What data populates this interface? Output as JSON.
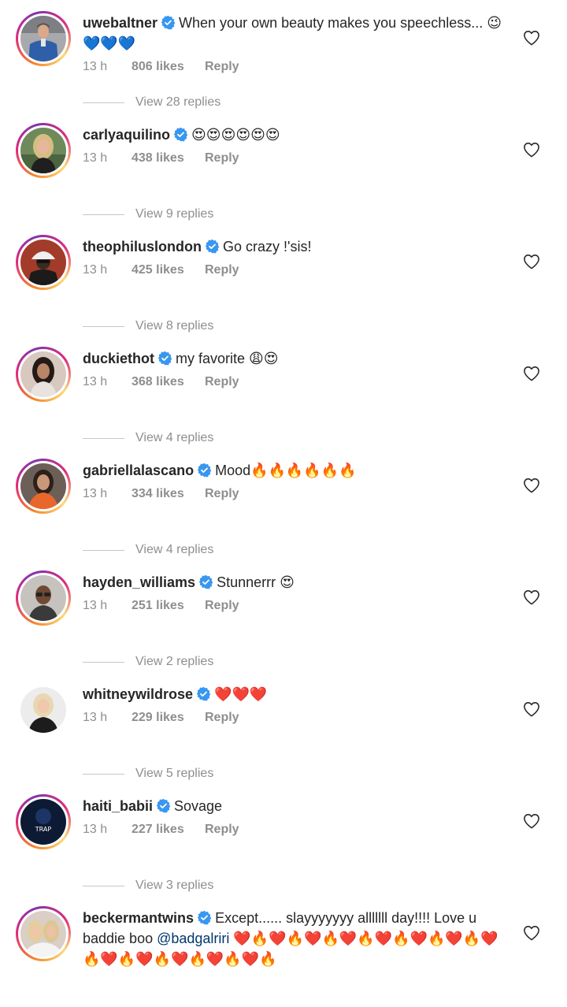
{
  "comments": [
    {
      "username": "uwebaltner",
      "text": "When your own beauty makes you speechless... 😉💙💙💙",
      "time": "13 h",
      "likes": "806 likes",
      "reply": "Reply",
      "view_replies": "View 28 replies",
      "has_story": true
    },
    {
      "username": "carlyaquilino",
      "text": "😍😍😍😍😍😍",
      "time": "13 h",
      "likes": "438 likes",
      "reply": "Reply",
      "view_replies": "View 9 replies",
      "has_story": true
    },
    {
      "username": "theophiluslondon",
      "text": "Go crazy !'sis!",
      "time": "13 h",
      "likes": "425 likes",
      "reply": "Reply",
      "view_replies": "View 8 replies",
      "has_story": true
    },
    {
      "username": "duckiethot",
      "text": "my favorite 😩😍",
      "time": "13 h",
      "likes": "368 likes",
      "reply": "Reply",
      "view_replies": "View 4 replies",
      "has_story": true
    },
    {
      "username": "gabriellalascano",
      "text": "Mood🔥🔥🔥🔥🔥🔥",
      "time": "13 h",
      "likes": "334 likes",
      "reply": "Reply",
      "view_replies": "View 4 replies",
      "has_story": true
    },
    {
      "username": "hayden_williams",
      "text": "Stunnerrr 😍",
      "time": "13 h",
      "likes": "251 likes",
      "reply": "Reply",
      "view_replies": "View 2 replies",
      "has_story": true
    },
    {
      "username": "whitneywildrose",
      "text": "❤️❤️❤️",
      "time": "13 h",
      "likes": "229 likes",
      "reply": "Reply",
      "view_replies": "View 5 replies",
      "has_story": false
    },
    {
      "username": "haiti_babii",
      "text": "Sovage",
      "time": "13 h",
      "likes": "227 likes",
      "reply": "Reply",
      "view_replies": "View 3 replies",
      "has_story": true
    },
    {
      "username": "beckermantwins",
      "text_before": "Except...... slayyyyyyy alllllll day!!!! Love u baddie boo ",
      "mention": "@badgalriri",
      "text_after": " ❤️🔥❤️🔥❤️🔥❤️🔥❤️🔥❤️🔥❤️🔥❤️🔥❤️🔥❤️🔥❤️🔥❤️🔥❤️🔥",
      "has_story": true
    }
  ],
  "colors": {
    "text": "#262626",
    "muted": "#8e8e8e",
    "verified": "#3897f0",
    "mention": "#00376b"
  },
  "icons": {
    "verified": "verified-badge-icon",
    "like": "heart-outline-icon"
  }
}
